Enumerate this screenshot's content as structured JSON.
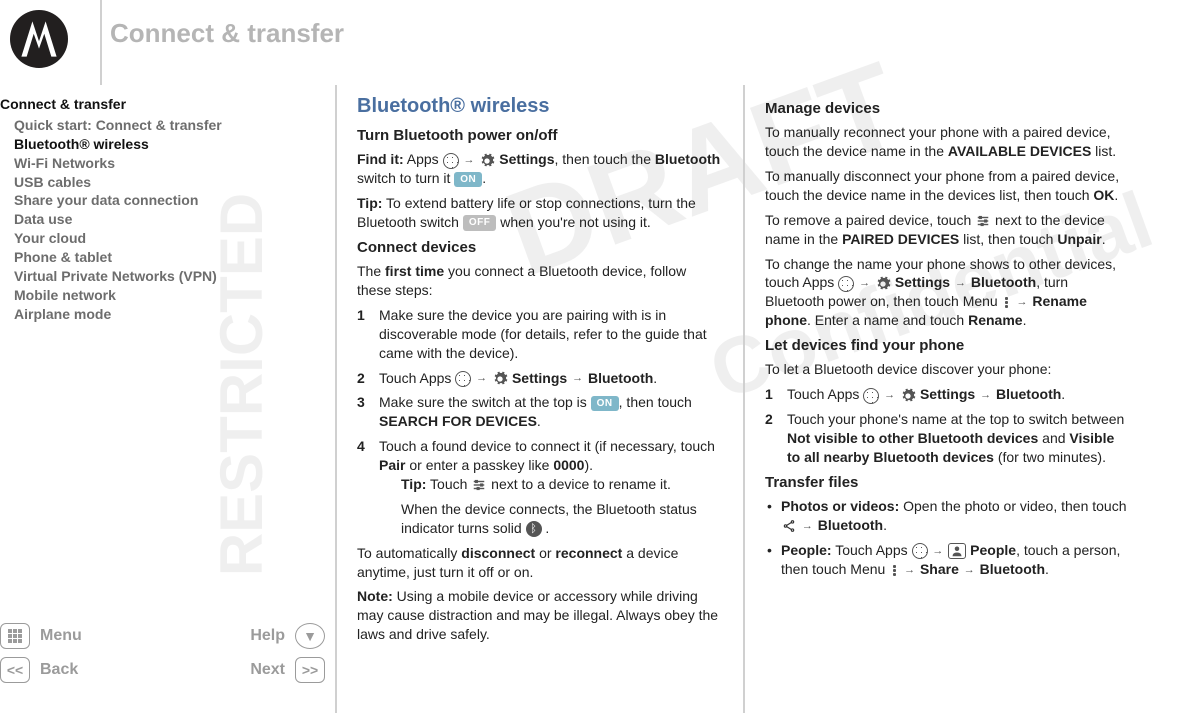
{
  "header": {
    "title": "Connect & transfer"
  },
  "sidebar": {
    "section_title": "Connect & transfer",
    "items": [
      "Quick start: Connect & transfer",
      "Bluetooth® wireless",
      "Wi-Fi Networks",
      "USB cables",
      "Share your data connection",
      "Data use",
      "Your cloud",
      "Phone & tablet",
      "Virtual Private Networks (VPN)",
      "Mobile network",
      "Airplane mode"
    ],
    "active_index": 1
  },
  "footernav": {
    "menu": "Menu",
    "help": "Help",
    "back": "Back",
    "next": "Next"
  },
  "pill_on": "ON",
  "pill_off": "OFF",
  "col1": {
    "h2": "Bluetooth® wireless",
    "h3a": "Turn Bluetooth power on/off",
    "find_it_label": "Find it:",
    "find_it_1": " Apps ",
    "find_it_settings": "Settings",
    "find_it_2": ", then touch the ",
    "find_it_bt": "Bluetooth",
    "find_it_3": " switch to turn it ",
    "tip_label": "Tip:",
    "tip_text_a": " To extend battery life or stop connections, turn the Bluetooth switch ",
    "tip_text_b": " when you're not using it.",
    "h3b": "Connect devices",
    "first_time_a": "The ",
    "first_time_b": "first time",
    "first_time_c": " you connect a Bluetooth device, follow these steps:",
    "li1": "Make sure the device you are pairing with is in discoverable mode (for details, refer to the guide that came with the device).",
    "li2_a": "Touch Apps ",
    "li2_settings": "Settings",
    "li2_bt": "Bluetooth",
    "li3_a": "Make sure the switch at the top is ",
    "li3_b": ", then touch ",
    "li3_search": "SEARCH FOR DEVICES",
    "li4_a": "Touch a found device to connect it (if necessary, touch ",
    "li4_pair": "Pair",
    "li4_b": " or enter a passkey like ",
    "li4_0000": "0000",
    "li4_c": ").",
    "li4_tip_label": "Tip:",
    "li4_tip_a": " Touch ",
    "li4_tip_b": " next to a device to rename it.",
    "li4_solid_a": "When the device connects, the Bluetooth status indicator turns solid ",
    "disc_a": "To automatically ",
    "disc_b": "disconnect",
    "disc_c": " or ",
    "disc_d": "reconnect",
    "disc_e": " a device anytime, just turn it off or on.",
    "note_label": "Note:",
    "note_text": " Using a mobile device or accessory while driving may cause distraction and may be illegal. Always obey the laws and drive safely."
  },
  "col2": {
    "h3a": "Manage devices",
    "p1_a": "To manually reconnect your phone with a paired device, touch the device name in the ",
    "p1_b": "AVAILABLE DEVICES",
    "p1_c": " list.",
    "p2_a": "To manually disconnect your phone from a paired device, touch the device name in the devices list, then touch ",
    "p2_ok": "OK",
    "p3_a": "To remove a paired device, touch ",
    "p3_b": " next to the device name in the ",
    "p3_paired": "PAIRED DEVICES",
    "p3_c": " list, then touch ",
    "p3_unpair": "Unpair",
    "p4_a": "To change the name your phone shows to other devices, touch Apps ",
    "p4_settings": "Settings",
    "p4_bt": "Bluetooth",
    "p4_b": ", turn Bluetooth power on, then touch Menu ",
    "p4_rename": "Rename phone",
    "p4_c": ". Enter a name and touch ",
    "p4_renameb": "Rename",
    "h3b": "Let devices find your phone",
    "p5": "To let a Bluetooth device discover your phone:",
    "li1_a": "Touch Apps ",
    "li1_settings": "Settings",
    "li1_bt": "Bluetooth",
    "li2_a": "Touch your phone's name at the top to switch between ",
    "li2_nv": "Not visible to other Bluetooth devices",
    "li2_and": " and ",
    "li2_v": "Visible to all nearby Bluetooth devices",
    "li2_b": " (for two minutes).",
    "h3c": "Transfer files",
    "b1_label": "Photos or videos:",
    "b1_a": " Open the photo or video, then touch ",
    "b1_bt": "Bluetooth",
    "b2_label": "People:",
    "b2_a": " Touch Apps ",
    "b2_people": "People",
    "b2_b": ", touch a person, then touch Menu ",
    "b2_share": "Share",
    "b2_bt": "Bluetooth"
  }
}
